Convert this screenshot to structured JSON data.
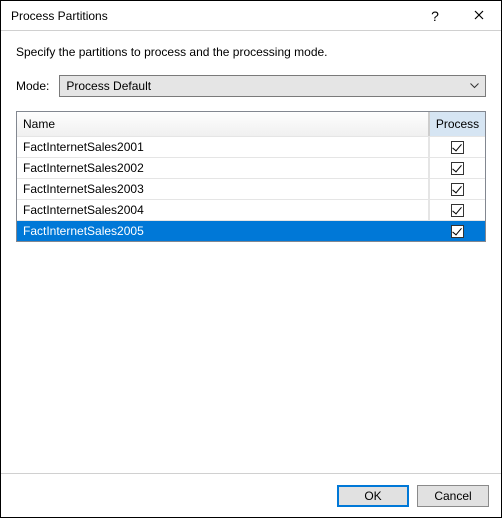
{
  "window": {
    "title": "Process Partitions",
    "help_symbol": "?",
    "close_symbol": "🗙"
  },
  "instruction": "Specify the partitions to process and the processing mode.",
  "mode": {
    "label": "Mode:",
    "selected": "Process Default"
  },
  "grid": {
    "columns": {
      "name": "Name",
      "process": "Process"
    },
    "rows": [
      {
        "name": "FactInternetSales2001",
        "checked": true,
        "selected": false
      },
      {
        "name": "FactInternetSales2002",
        "checked": true,
        "selected": false
      },
      {
        "name": "FactInternetSales2003",
        "checked": true,
        "selected": false
      },
      {
        "name": "FactInternetSales2004",
        "checked": true,
        "selected": false
      },
      {
        "name": "FactInternetSales2005",
        "checked": true,
        "selected": true
      }
    ]
  },
  "buttons": {
    "ok": "OK",
    "cancel": "Cancel"
  }
}
